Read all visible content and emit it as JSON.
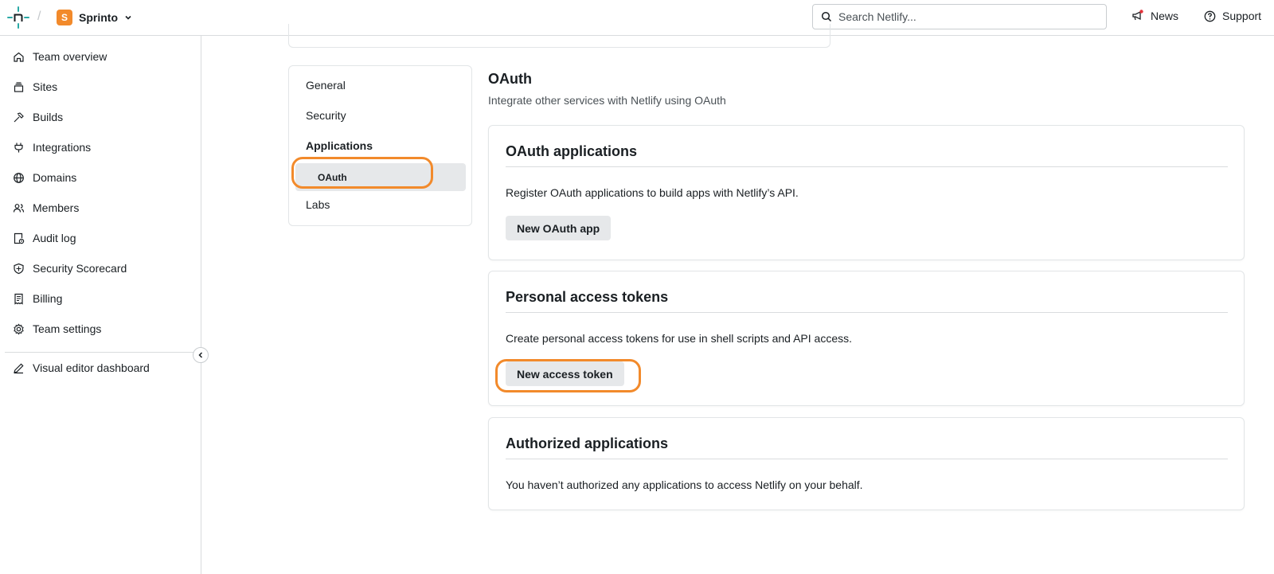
{
  "header": {
    "team_avatar_letter": "S",
    "team_name": "Sprinto",
    "search_placeholder": "Search Netlify...",
    "news_label": "News",
    "support_label": "Support",
    "accent_color": "#f28a2b",
    "logo_color": "#2aa9a6"
  },
  "sidebar": {
    "items": [
      {
        "label": "Team overview",
        "icon": "home-icon"
      },
      {
        "label": "Sites",
        "icon": "sites-icon"
      },
      {
        "label": "Builds",
        "icon": "hammer-icon"
      },
      {
        "label": "Integrations",
        "icon": "plug-icon"
      },
      {
        "label": "Domains",
        "icon": "globe-icon"
      },
      {
        "label": "Members",
        "icon": "users-icon"
      },
      {
        "label": "Audit log",
        "icon": "audit-log-icon"
      },
      {
        "label": "Security Scorecard",
        "icon": "shield-icon"
      },
      {
        "label": "Billing",
        "icon": "receipt-icon"
      },
      {
        "label": "Team settings",
        "icon": "gear-icon"
      }
    ],
    "secondary": {
      "label": "Visual editor dashboard",
      "icon": "pencil-icon"
    }
  },
  "subnav": {
    "general": "General",
    "security": "Security",
    "applications": "Applications",
    "oauth": "OAuth",
    "labs": "Labs"
  },
  "main": {
    "title": "OAuth",
    "subtitle": "Integrate other services with Netlify using OAuth",
    "oauth_apps": {
      "title": "OAuth applications",
      "description": "Register OAuth applications to build apps with Netlify’s API.",
      "button": "New OAuth app"
    },
    "tokens": {
      "title": "Personal access tokens",
      "description": "Create personal access tokens for use in shell scripts and API access.",
      "button": "New access token"
    },
    "authorized": {
      "title": "Authorized applications",
      "description": "You haven’t authorized any applications to access Netlify on your behalf."
    }
  }
}
